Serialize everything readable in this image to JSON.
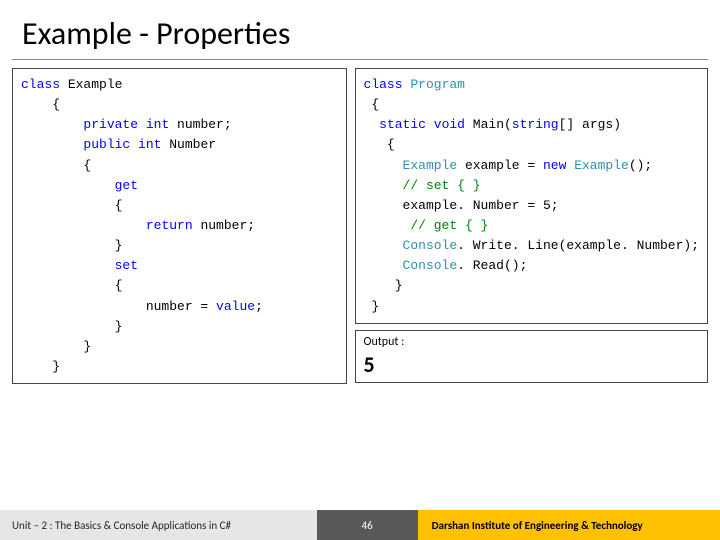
{
  "title": "Example - Properties",
  "code_left": {
    "l1_kw": "class",
    "l1_t": " Example",
    "l2": "    {",
    "l3_a": "        ",
    "l3_kw1": "private",
    "l3_b": " ",
    "l3_kw2": "int",
    "l3_c": " number;",
    "l4_a": "        ",
    "l4_kw1": "public",
    "l4_b": " ",
    "l4_kw2": "int",
    "l4_c": " Number",
    "l5": "        {",
    "l6_a": "            ",
    "l6_kw": "get",
    "l7": "            {",
    "l8_a": "                ",
    "l8_kw": "return",
    "l8_b": " number;",
    "l9": "            }",
    "l10_a": "            ",
    "l10_kw": "set",
    "l11": "            {",
    "l12_a": "                number = ",
    "l12_kw": "value",
    "l12_b": ";",
    "l13": "            }",
    "l14": "        }",
    "l15": "    }"
  },
  "code_right": {
    "l1_kw": "class",
    "l1_sp": " ",
    "l1_typ": "Program",
    "l2": " {",
    "l3_a": "  ",
    "l3_kw1": "static",
    "l3_b": " ",
    "l3_kw2": "void",
    "l3_c": " Main(",
    "l3_kw3": "string",
    "l3_d": "[] args)",
    "l4": "   {",
    "l5_a": "     ",
    "l5_typ": "Example",
    "l5_b": " example = ",
    "l5_kw": "new",
    "l5_c": " ",
    "l5_typ2": "Example",
    "l5_d": "();",
    "l6_a": "     ",
    "l6_com": "// set { }",
    "l7": "     example. Number = 5;",
    "l8_a": "      ",
    "l8_com": "// get { }",
    "l9_a": "     ",
    "l9_typ": "Console",
    "l9_b": ". Write. Line(example. Number);",
    "l10_a": "     ",
    "l10_typ": "Console",
    "l10_b": ". Read();",
    "l11": "    }",
    "l12": " }"
  },
  "output": {
    "label": "Output :",
    "value": "5"
  },
  "footer": {
    "left": "Unit – 2 : The Basics & Console Applications in C#",
    "page": "46",
    "right": "Darshan Institute of Engineering & Technology"
  }
}
